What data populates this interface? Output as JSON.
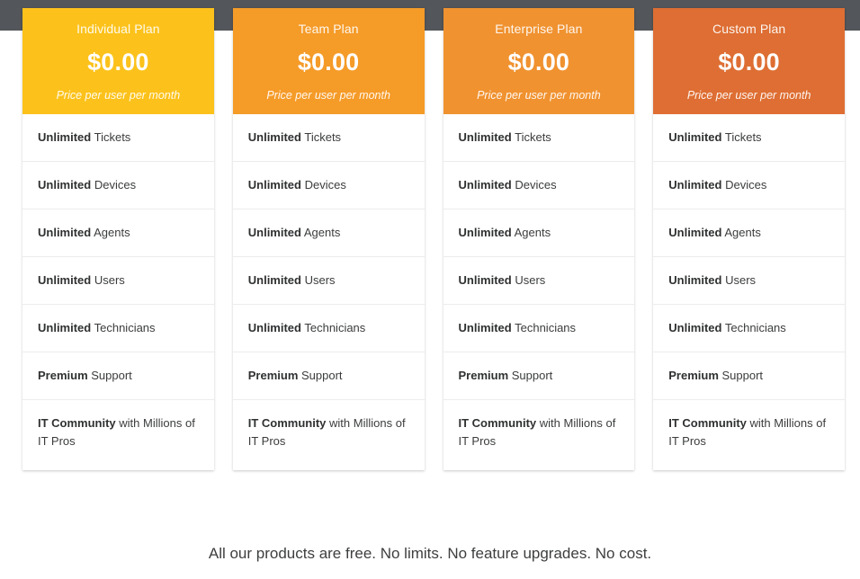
{
  "theme": {
    "top_band_color": "#53565a",
    "page_background": "#ffffff",
    "card_background": "#ffffff",
    "divider_color": "#ececec",
    "feature_text_color": "#3b3c3d",
    "tagline_color": "#3d3e3f"
  },
  "plans": [
    {
      "name": "Individual Plan",
      "price": "$0.00",
      "period": "Price per user per month",
      "header_color": "#FCC21B",
      "features": [
        {
          "strong": "Unlimited",
          "rest": " Tickets"
        },
        {
          "strong": "Unlimited",
          "rest": " Devices"
        },
        {
          "strong": "Unlimited",
          "rest": " Agents"
        },
        {
          "strong": "Unlimited",
          "rest": " Users"
        },
        {
          "strong": "Unlimited",
          "rest": " Technicians"
        },
        {
          "strong": "Premium",
          "rest": " Support"
        },
        {
          "strong": "IT Community",
          "rest": " with Millions of IT Pros"
        }
      ]
    },
    {
      "name": "Team Plan",
      "price": "$0.00",
      "period": "Price per user per month",
      "header_color": "#F59B28",
      "features": [
        {
          "strong": "Unlimited",
          "rest": " Tickets"
        },
        {
          "strong": "Unlimited",
          "rest": " Devices"
        },
        {
          "strong": "Unlimited",
          "rest": " Agents"
        },
        {
          "strong": "Unlimited",
          "rest": " Users"
        },
        {
          "strong": "Unlimited",
          "rest": " Technicians"
        },
        {
          "strong": "Premium",
          "rest": " Support"
        },
        {
          "strong": "IT Community",
          "rest": " with Millions of IT Pros"
        }
      ]
    },
    {
      "name": "Enterprise Plan",
      "price": "$0.00",
      "period": "Price per user per month",
      "header_color": "#F09230",
      "features": [
        {
          "strong": "Unlimited",
          "rest": " Tickets"
        },
        {
          "strong": "Unlimited",
          "rest": " Devices"
        },
        {
          "strong": "Unlimited",
          "rest": " Agents"
        },
        {
          "strong": "Unlimited",
          "rest": " Users"
        },
        {
          "strong": "Unlimited",
          "rest": " Technicians"
        },
        {
          "strong": "Premium",
          "rest": " Support"
        },
        {
          "strong": "IT Community",
          "rest": " with Millions of IT Pros"
        }
      ]
    },
    {
      "name": "Custom Plan",
      "price": "$0.00",
      "period": "Price per user per month",
      "header_color": "#DE6E33",
      "features": [
        {
          "strong": "Unlimited",
          "rest": " Tickets"
        },
        {
          "strong": "Unlimited",
          "rest": " Devices"
        },
        {
          "strong": "Unlimited",
          "rest": " Agents"
        },
        {
          "strong": "Unlimited",
          "rest": " Users"
        },
        {
          "strong": "Unlimited",
          "rest": " Technicians"
        },
        {
          "strong": "Premium",
          "rest": " Support"
        },
        {
          "strong": "IT Community",
          "rest": " with Millions of IT Pros"
        }
      ]
    }
  ],
  "footer": {
    "tagline": "All our products are free. No limits. No feature upgrades. No cost."
  }
}
